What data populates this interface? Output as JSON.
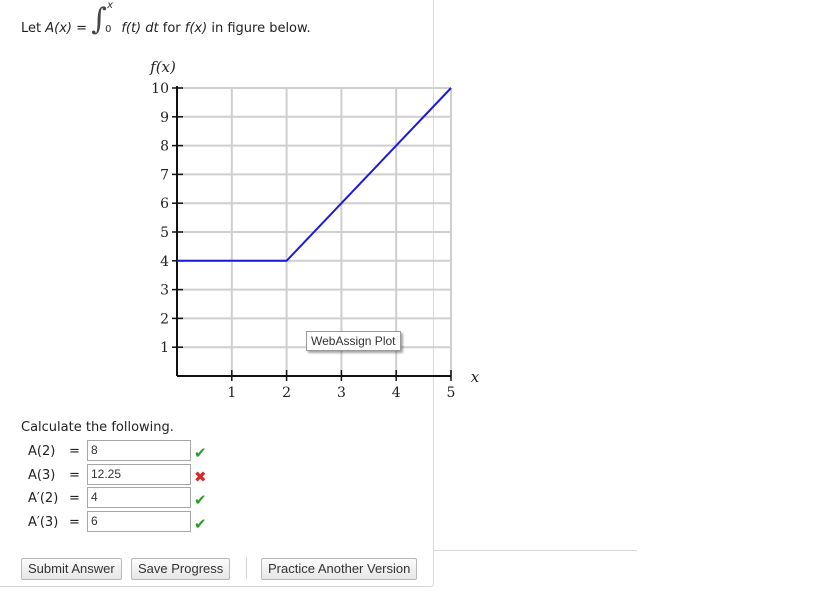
{
  "prompt": {
    "prefix": "Let",
    "func": "A(x)",
    "equals": "=",
    "upper_limit": "x",
    "lower_limit": "0",
    "integrand": "f(t) dt",
    "suffix_for": "for",
    "fx": "f(x)",
    "suffix": "in figure below."
  },
  "chart_data": {
    "type": "line",
    "ylabel": "f(x)",
    "xlabel": "x",
    "xlim": [
      0,
      5
    ],
    "ylim": [
      0,
      10
    ],
    "x_ticks": [
      "1",
      "2",
      "3",
      "4",
      "5"
    ],
    "y_ticks": [
      "1",
      "2",
      "3",
      "4",
      "5",
      "6",
      "7",
      "8",
      "9",
      "10"
    ],
    "grid": true,
    "series": [
      {
        "x": [
          0,
          2,
          5
        ],
        "y": [
          4,
          4,
          10
        ],
        "color": "#1a1adb"
      }
    ]
  },
  "tooltip": "WebAssign Plot",
  "calc_title": "Calculate the following.",
  "answers": [
    {
      "label": "A(2)",
      "value": "8",
      "correct": true
    },
    {
      "label": "A(3)",
      "value": "12.25",
      "correct": false
    },
    {
      "label": "A′(2)",
      "value": "4",
      "correct": true
    },
    {
      "label": "A′(3)",
      "value": "6",
      "correct": true
    }
  ],
  "equals_sign": "=",
  "marks": {
    "correct_icon": "✔",
    "wrong_icon": "✖",
    "correct_color": "#2e9a2e",
    "wrong_color": "#d52a2a"
  },
  "buttons": {
    "submit": "Submit Answer",
    "save": "Save Progress",
    "practice": "Practice Another Version"
  }
}
